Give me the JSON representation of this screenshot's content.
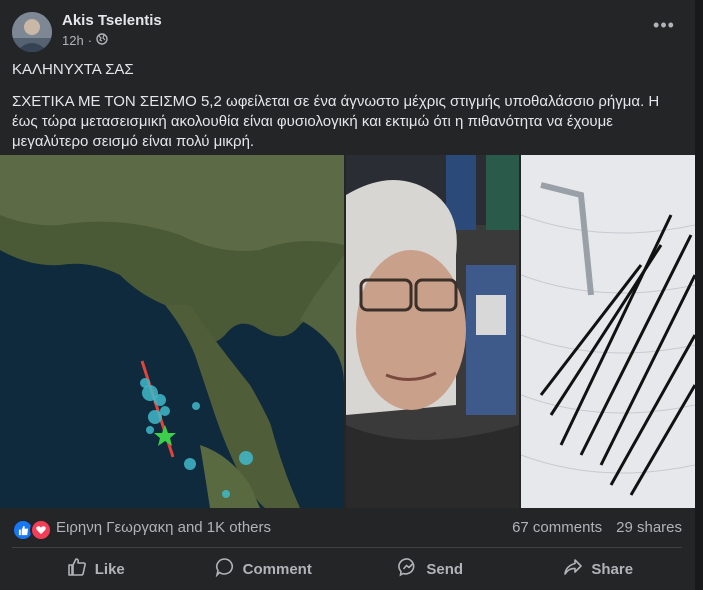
{
  "post": {
    "author": "Akis Tselentis",
    "time": "12h",
    "privacy_icon": "globe-icon",
    "more_icon": "more-options-icon",
    "text_line1": "ΚΑΛΗΝΥΧΤΑ ΣΑΣ",
    "text_body": "ΣΧΕΤΙΚΑ ΜΕ ΤΟΝ ΣΕΙΣΜΟ 5,2 ωφείλεται σε ένα άγνωστο μέχρις στιγμής υποθαλάσσιο ρήγμα. Η έως τώρα μετασεισμική ακολουθία είναι φυσιολογική και εκτιμώ ότι η πιθανότητα να έχουμε μεγαλύτερο σεισμό είναι πολύ μικρή."
  },
  "reactions": {
    "icons": [
      "like-reaction-icon",
      "love-reaction-icon"
    ],
    "summary": "Ειρηνη Γεωργακη and 1K others",
    "comments": "67 comments",
    "shares": "29 shares"
  },
  "actions": {
    "like": "Like",
    "comment": "Comment",
    "send": "Send",
    "share": "Share"
  },
  "colors": {
    "background": "#18191a",
    "card": "#242526",
    "text": "#e4e6eb",
    "secondary": "#b0b3b8",
    "like_blue": "#1877f2",
    "love_red": "#f33e58"
  }
}
